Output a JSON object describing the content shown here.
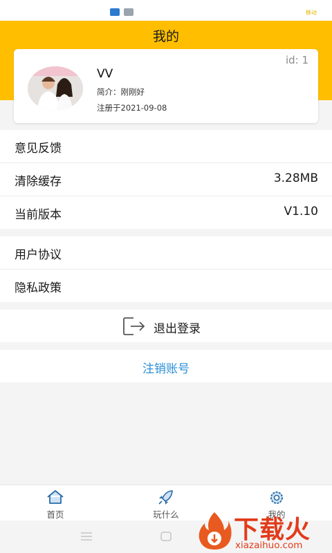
{
  "status_bar": {
    "carrier": "移动"
  },
  "header": {
    "title": "我的"
  },
  "profile": {
    "username": "VV",
    "bio": "简介：刚刚好",
    "registered": "注册于2021-09-08",
    "id": "id: 1"
  },
  "menu": {
    "group1": [
      {
        "label": "意见反馈",
        "value": ""
      },
      {
        "label": "清除缓存",
        "value": "3.28MB"
      },
      {
        "label": "当前版本",
        "value": "V1.10"
      }
    ],
    "group2": [
      {
        "label": "用户协议"
      },
      {
        "label": "隐私政策"
      }
    ]
  },
  "logout": {
    "label": "退出登录"
  },
  "cancel_account": {
    "label": "注销账号"
  },
  "tabbar": {
    "tabs": [
      {
        "label": "首页",
        "icon": "home-icon"
      },
      {
        "label": "玩什么",
        "icon": "rocket-icon"
      },
      {
        "label": "我的",
        "icon": "gear-icon"
      }
    ]
  },
  "watermark": {
    "title": "下载火",
    "url": "xiazaihuo.com"
  },
  "colors": {
    "accent": "#ffbf00",
    "link": "#2b8fd6",
    "watermark": "#e23b1a",
    "tab_icon": "#2a6ba8"
  }
}
